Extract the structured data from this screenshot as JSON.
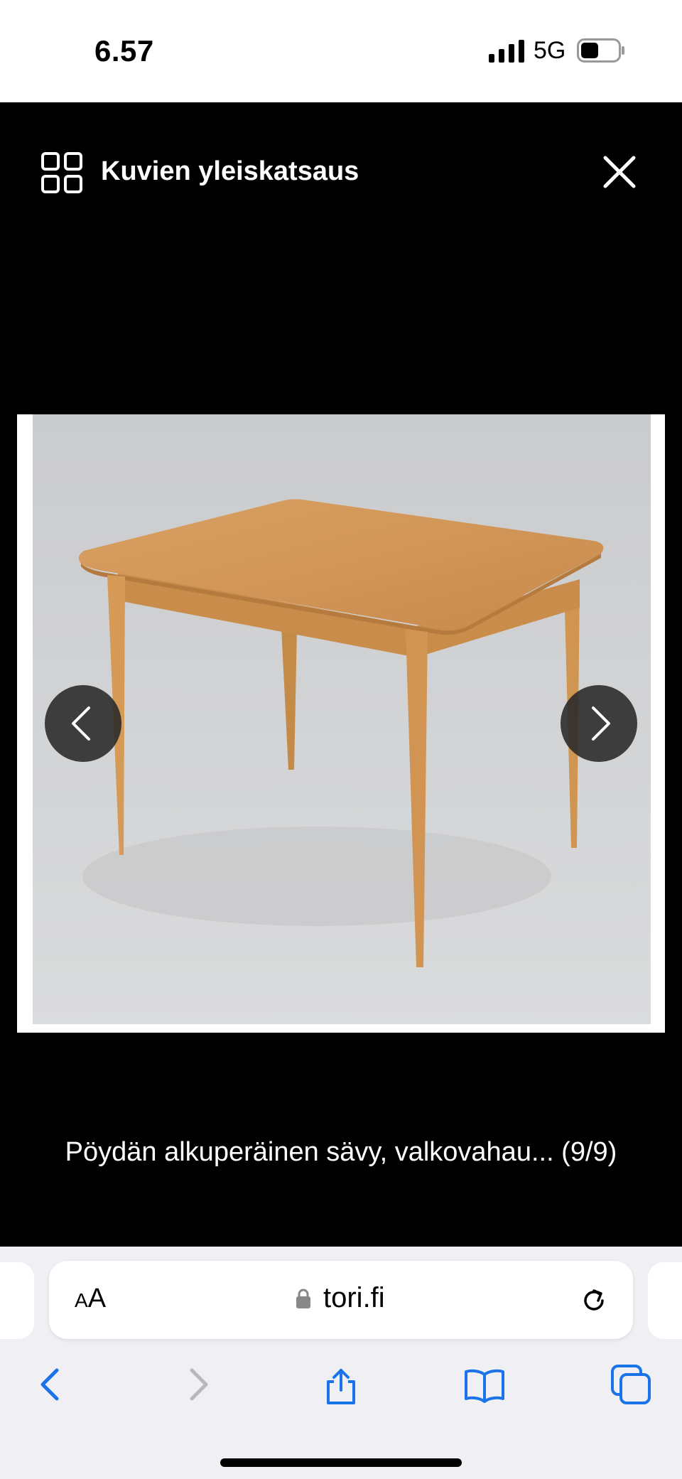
{
  "status_bar": {
    "time": "6.57",
    "network": "5G",
    "icons": [
      "signal-bars-icon",
      "battery-icon"
    ]
  },
  "viewer": {
    "title": "Kuvien yleiskatsaus",
    "title_icon": "grid-icon",
    "close_icon": "close-icon",
    "prev_icon": "chevron-left-icon",
    "next_icon": "chevron-right-icon",
    "caption": "Pöydän alkuperäinen sävy, valkovahau... (9/9)",
    "photo_subject": "wooden-table-photo"
  },
  "browser": {
    "text_size_label_small": "A",
    "text_size_label_large": "A",
    "url": "tori.fi",
    "toolbar_icons": [
      "back-icon",
      "forward-icon",
      "share-icon",
      "bookmarks-icon",
      "tabs-icon"
    ],
    "accent_color": "#1a73e8"
  }
}
